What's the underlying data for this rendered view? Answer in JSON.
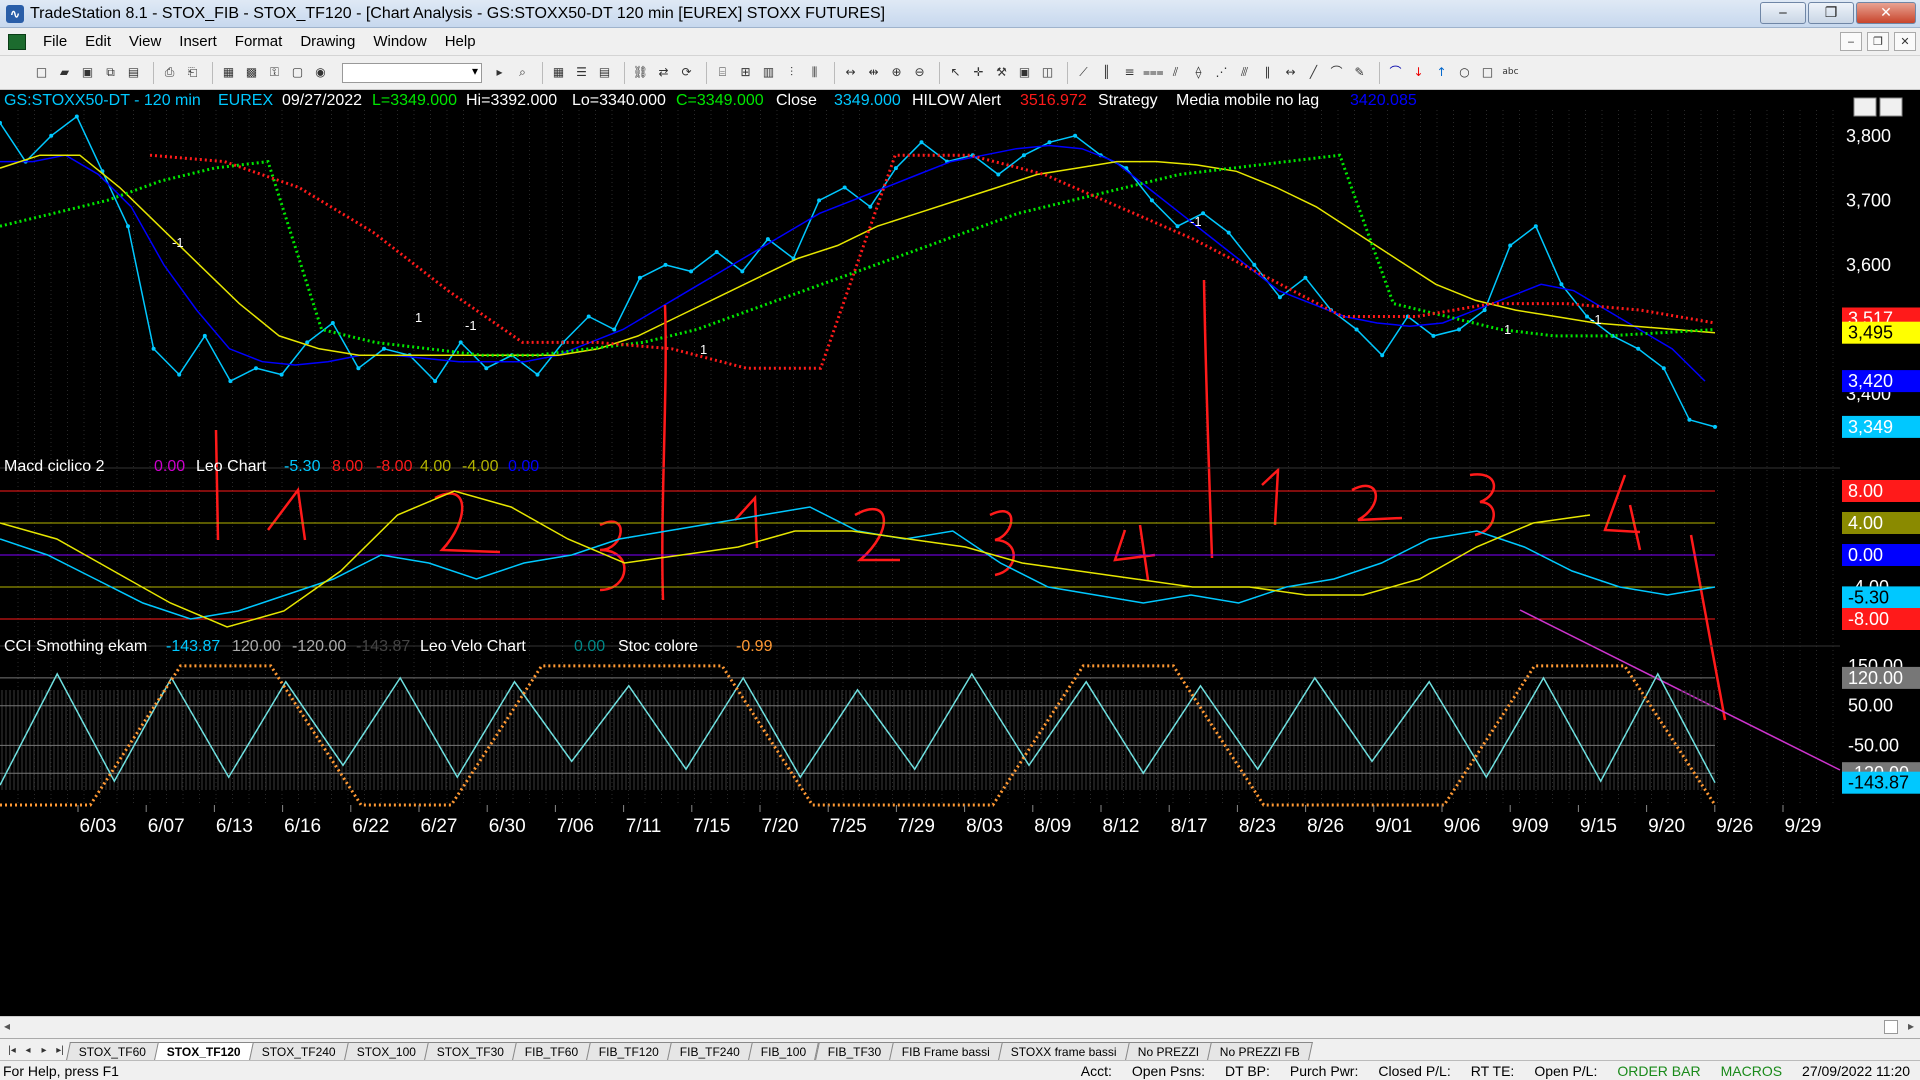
{
  "window": {
    "title": "TradeStation 8.1 - STOX_FIB - STOX_TF120 - [Chart Analysis - GS:STOXX50-DT  120 min  [EUREX] STOXX FUTURES]"
  },
  "menu": [
    "File",
    "Edit",
    "View",
    "Insert",
    "Format",
    "Drawing",
    "Window",
    "Help"
  ],
  "header": {
    "symbol": "GS:STOXX50-DT - 120 min",
    "exchange": "EUREX",
    "date": "09/27/2022",
    "last": "L=3349.000",
    "hi": "Hi=3392.000",
    "lo": "Lo=3340.000",
    "close_c": "C=3349.000",
    "close_label": "Close",
    "close_val": "3349.000",
    "hilow_label": "HILOW Alert",
    "hilow_val": "3516.972",
    "strategy": "Strategy",
    "media_label": "Media mobile no lag",
    "media_val": "3420.085"
  },
  "macd_header": {
    "name": "Macd ciclico 2",
    "v0": "0.00",
    "leo": "Leo Chart",
    "leo_vals": [
      "-5.30",
      "8.00",
      "-8.00",
      "4.00",
      "-4.00",
      "0.00"
    ]
  },
  "cci_header": {
    "name": "CCI Smothing ekam",
    "vals": [
      "-143.87",
      "120.00",
      "-120.00",
      "-143.87"
    ],
    "velo": "Leo Velo Chart",
    "velo_val": "0.00",
    "stoc": "Stoc colore",
    "stoc_val": "-0.99"
  },
  "chart_data": [
    {
      "type": "line",
      "title": "GS:STOXX50-DT - 120 min",
      "xlabel": "",
      "ylabel": "",
      "x_ticks": [
        "6/03",
        "6/07",
        "6/13",
        "6/16",
        "6/22",
        "6/27",
        "6/30",
        "7/06",
        "7/11",
        "7/15",
        "7/20",
        "7/25",
        "7/29",
        "8/03",
        "8/09",
        "8/12",
        "8/17",
        "8/23",
        "8/26",
        "9/01",
        "9/06",
        "9/09",
        "9/15",
        "9/20",
        "9/26",
        "9/29"
      ],
      "y_ticks": [
        "3,800",
        "3,700",
        "3,600",
        "3,400"
      ],
      "ylim": [
        3290,
        3840
      ],
      "price_labels": [
        {
          "value": "3,517",
          "color": "#ff1a1a"
        },
        {
          "value": "3,495",
          "color": "#ffff00"
        },
        {
          "value": "3,420",
          "color": "#0000ff"
        },
        {
          "value": "3,349",
          "color": "#00c8ff"
        }
      ],
      "series": [
        {
          "color": "#00c8ff",
          "values": [
            3820,
            3760,
            3800,
            3830,
            3745,
            3660,
            3470,
            3430,
            3490,
            3420,
            3440,
            3430,
            3480,
            3510,
            3440,
            3470,
            3460,
            3420,
            3480,
            3440,
            3460,
            3430,
            3480,
            3520,
            3500,
            3580,
            3600,
            3590,
            3620,
            3590,
            3640,
            3610,
            3700,
            3720,
            3690,
            3750,
            3790,
            3760,
            3770,
            3740,
            3770,
            3790,
            3800,
            3770,
            3750,
            3700,
            3660,
            3680,
            3650,
            3600,
            3550,
            3580,
            3530,
            3500,
            3460,
            3520,
            3490,
            3500,
            3530,
            3630,
            3660,
            3570,
            3520,
            3490,
            3470,
            3440,
            3360,
            3349
          ]
        },
        {
          "color": "#0000ff",
          "values": [
            3760,
            3760,
            3770,
            3740,
            3690,
            3600,
            3530,
            3470,
            3450,
            3445,
            3450,
            3460,
            3460,
            3455,
            3450,
            3450,
            3450,
            3460,
            3480,
            3500,
            3530,
            3560,
            3590,
            3620,
            3650,
            3680,
            3700,
            3720,
            3740,
            3760,
            3770,
            3780,
            3785,
            3780,
            3760,
            3720,
            3680,
            3640,
            3600,
            3560,
            3540,
            3520,
            3510,
            3505,
            3510,
            3530,
            3550,
            3570,
            3560,
            3530,
            3500,
            3470,
            3420
          ]
        },
        {
          "color": "#e6e600",
          "values": [
            3750,
            3770,
            3770,
            3720,
            3660,
            3600,
            3540,
            3490,
            3470,
            3460,
            3460,
            3460,
            3460,
            3460,
            3460,
            3470,
            3490,
            3520,
            3550,
            3580,
            3610,
            3630,
            3660,
            3680,
            3700,
            3720,
            3740,
            3750,
            3760,
            3760,
            3755,
            3745,
            3720,
            3690,
            3650,
            3610,
            3570,
            3545,
            3530,
            3520,
            3510,
            3505,
            3500,
            3495
          ]
        },
        {
          "color": "#00e600",
          "values": [
            3660,
            3680,
            3700,
            3730,
            3750,
            3760,
            3500,
            3480,
            3470,
            3460,
            3460,
            3470,
            3480,
            3500,
            3530,
            3560,
            3590,
            3620,
            3650,
            3680,
            3700,
            3720,
            3740,
            3750,
            3760,
            3770,
            3540,
            3520,
            3500,
            3490,
            3490,
            3495,
            3500
          ]
        },
        {
          "color": "#ff1a1a",
          "values": [
            3770,
            3760,
            3720,
            3650,
            3560,
            3480,
            3480,
            3470,
            3440,
            3440,
            3770,
            3770,
            3740,
            3690,
            3640,
            3580,
            3520,
            3520,
            3540,
            3540,
            3530,
            3510
          ]
        }
      ]
    },
    {
      "type": "line",
      "title": "Macd ciclico 2",
      "xlabel": "",
      "ylabel": "",
      "y_ticks": [
        "8.00",
        "4.00",
        "0.00",
        "-4.00",
        "-5.30",
        "-8.00"
      ],
      "ylim": [
        -10,
        10
      ],
      "series": [
        {
          "color": "#00c8ff",
          "values": [
            2,
            0,
            -3,
            -6,
            -8,
            -7,
            -5,
            -3,
            0,
            -1,
            -3,
            -1,
            0,
            2,
            3,
            4,
            5,
            6,
            3,
            2,
            3,
            -1,
            -4,
            -5,
            -6,
            -5,
            -6,
            -4,
            -3,
            -1,
            2,
            3,
            1,
            -2,
            -4,
            -5,
            -4
          ]
        },
        {
          "color": "#e6e600",
          "values": [
            4,
            2,
            -2,
            -6,
            -9,
            -7,
            -2,
            5,
            8,
            6,
            2,
            -1,
            0,
            1,
            3,
            3,
            2,
            1,
            -1,
            -2,
            -3,
            -4,
            -4,
            -5,
            -5,
            -3,
            1,
            4,
            5
          ]
        }
      ]
    },
    {
      "type": "line",
      "title": "CCI Smothing ekam",
      "xlabel": "",
      "ylabel": "",
      "y_ticks": [
        "150.00",
        "120.00",
        "50.00",
        "-50.00",
        "-120.00",
        "-143.87"
      ],
      "ylim": [
        -200,
        170
      ],
      "series": [
        {
          "color": "#6fe0e0",
          "values": [
            -150,
            130,
            -140,
            120,
            -130,
            110,
            -100,
            120,
            -130,
            110,
            -90,
            100,
            -110,
            120,
            -130,
            90,
            -110,
            130,
            -100,
            110,
            -120,
            100,
            -110,
            120,
            -90,
            110,
            -130,
            120,
            -140,
            130,
            -143.87
          ]
        },
        {
          "color": "#ff9933",
          "values": [
            -200,
            -200,
            150,
            150,
            -200,
            -200,
            150,
            150,
            150,
            -200,
            -200,
            -200,
            150,
            150,
            -200,
            -200,
            -200,
            150,
            150,
            -200
          ]
        }
      ]
    }
  ],
  "tabs": [
    "STOX_TF60",
    "STOX_TF120",
    "STOX_TF240",
    "STOX_100",
    "STOX_TF30",
    "FIB_TF60",
    "FIB_TF120",
    "FIB_TF240",
    "FIB_100",
    "FIB_TF30",
    "FIB Frame bassi",
    "STOXX frame bassi",
    "No PREZZI",
    "No PREZZI FB"
  ],
  "status": {
    "help": "For Help, press F1",
    "acct": "Acct:",
    "open_psns": "Open Psns:",
    "dt_bp": "DT BP:",
    "purch_pwr": "Purch Pwr:",
    "closed_pl": "Closed P/L:",
    "rt_te": "RT TE:",
    "open_pl": "Open P/L:",
    "order_bar": "ORDER BAR",
    "macros": "MACROS",
    "datetime": "27/09/2022 11:20"
  },
  "colors": {
    "accent": "#00c8ff",
    "red": "#ff1a1a",
    "green": "#00e600",
    "yellow": "#e6e600",
    "blue": "#0000ff"
  }
}
